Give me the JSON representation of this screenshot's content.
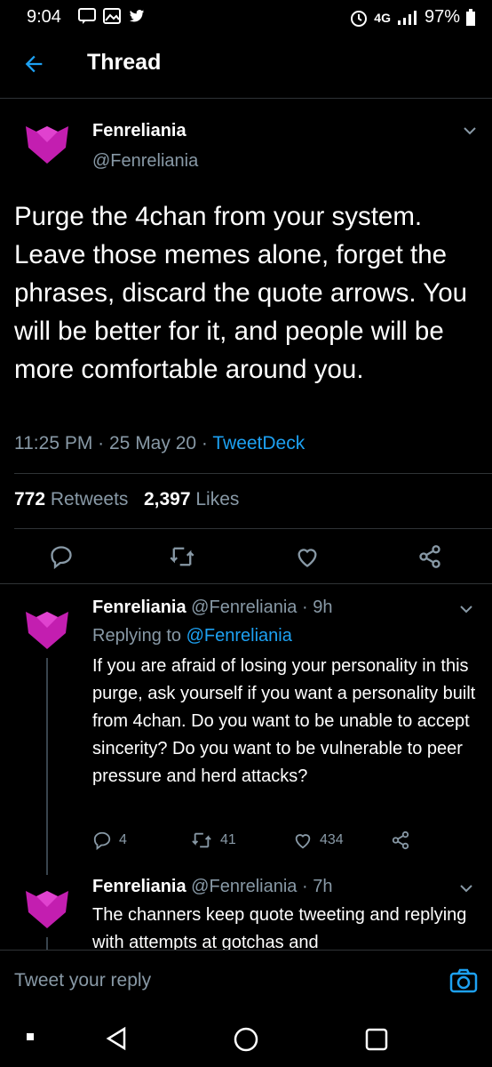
{
  "status": {
    "time": "9:04",
    "battery": "97%",
    "network": "4G"
  },
  "header": {
    "title": "Thread"
  },
  "tweet": {
    "name": "Fenreliania",
    "handle": "@Fenreliania",
    "text": "Purge the 4chan from your system. Leave those memes alone, forget the phrases, discard the quote arrows. You will be better for it, and people will be more comfortable around you.",
    "time": "11:25 PM",
    "date": "25 May 20",
    "source": "TweetDeck",
    "retweets": "772",
    "retweets_label": "Retweets",
    "likes": "2,397",
    "likes_label": "Likes"
  },
  "replies": [
    {
      "name": "Fenreliania",
      "handle": "@Fenreliania",
      "age": "9h",
      "replying_label": "Replying to",
      "replying_to": "@Fenreliania",
      "text": "If you are afraid of losing your personality in this purge, ask yourself if you want a personality built from 4chan. Do you want to be unable to accept sincerity? Do you want to be vulnerable to peer pressure and herd attacks?",
      "reply_count": "4",
      "retweet_count": "41",
      "like_count": "434"
    },
    {
      "name": "Fenreliania",
      "handle": "@Fenreliania",
      "age": "7h",
      "text": "The channers keep quote tweeting and replying with attempts at gotchas and"
    }
  ],
  "compose": {
    "placeholder": "Tweet your reply"
  },
  "colors": {
    "accent": "#1da1f2",
    "logo": "#c31eb0",
    "muted": "#8899a6"
  }
}
